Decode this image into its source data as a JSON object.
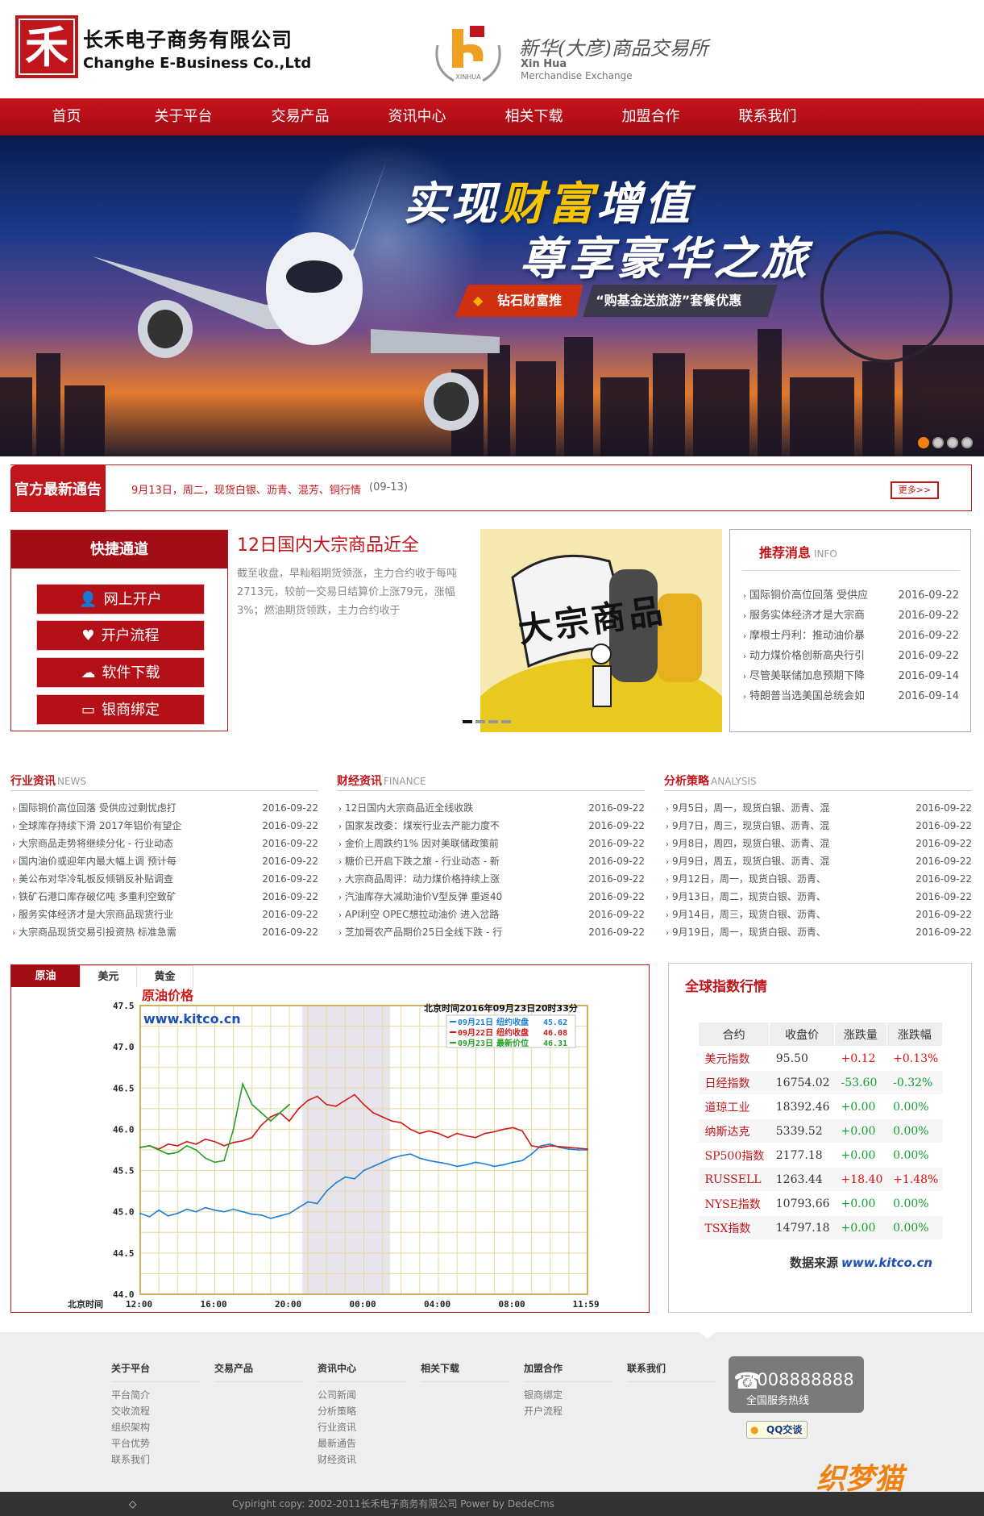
{
  "header": {
    "logo_char": "禾",
    "company_cn": "长禾电子商务有限公司",
    "company_en": "Changhe E-Business Co.,Ltd",
    "partner_cn": "新华(大彦)商品交易所",
    "partner_en1": "Xin Hua",
    "partner_en2": "Merchandise Exchange",
    "partner_logo_text": "XINHUA"
  },
  "nav": [
    "首页",
    "关于平台",
    "交易产品",
    "资讯中心",
    "相关下载",
    "加盟合作",
    "联系我们"
  ],
  "banner": {
    "line1_a": "实现",
    "line1_b": "财富",
    "line1_c": "增值",
    "line2": "尊享豪华之旅",
    "tag1": "钻石财富推出",
    "tag2": "“购基金送旅游”套餐优惠活动"
  },
  "notice": {
    "title": "官方最新通告",
    "text": "9月13日，周二，现货白银、沥青、混芳、铜行情",
    "date": "(09-13)",
    "more": "更多>>"
  },
  "quick": {
    "title": "快捷通道",
    "buttons": [
      "网上开户",
      "开户流程",
      "软件下载",
      "银商绑定"
    ]
  },
  "feature": {
    "title": "12日国内大宗商品近全",
    "body": "截至收盘，早籼稻期货领涨，主力合约收于每吨2713元，较前一交易日结算价上涨79元，涨幅3%；燃油期货领跌，主力合约收于",
    "image_text": "大宗商品"
  },
  "recommend": {
    "title": "推荐消息",
    "sub": "INFO",
    "items": [
      {
        "t": "国际铜价高位回落 受供应",
        "d": "2016-09-22"
      },
      {
        "t": "服务实体经济才是大宗商",
        "d": "2016-09-22"
      },
      {
        "t": "摩根士丹利：推动油价暴",
        "d": "2016-09-22"
      },
      {
        "t": "动力煤价格创新高央行引",
        "d": "2016-09-22"
      },
      {
        "t": "尽管美联储加息预期下降",
        "d": "2016-09-14"
      },
      {
        "t": "特朗普当选美国总统会如",
        "d": "2016-09-14"
      }
    ]
  },
  "columns": [
    {
      "title": "行业资讯",
      "sub": "NEWS",
      "items": [
        {
          "t": "国际铜价高位回落 受供应过剩忧虑打",
          "d": "2016-09-22"
        },
        {
          "t": "全球库存持续下滑 2017年铝价有望企",
          "d": "2016-09-22"
        },
        {
          "t": "大宗商品走势将继续分化 - 行业动态",
          "d": "2016-09-22"
        },
        {
          "t": "国内油价或迎年内最大幅上调 预计每",
          "d": "2016-09-22"
        },
        {
          "t": "美公布对华冷轧板反倾销反补贴调查",
          "d": "2016-09-22"
        },
        {
          "t": "铁矿石港口库存破亿吨 多重利空致矿",
          "d": "2016-09-22"
        },
        {
          "t": "服务实体经济才是大宗商品现货行业",
          "d": "2016-09-22"
        },
        {
          "t": "大宗商品现货交易引投资热 标准急需",
          "d": "2016-09-22"
        }
      ]
    },
    {
      "title": "财经资讯",
      "sub": "FINANCE",
      "items": [
        {
          "t": "12日国内大宗商品近全线收跌",
          "d": "2016-09-22"
        },
        {
          "t": "国家发改委：煤炭行业去产能力度不",
          "d": "2016-09-22"
        },
        {
          "t": "金价上周跌约1% 因对美联储政策前",
          "d": "2016-09-22"
        },
        {
          "t": "糖价已开启下跌之旅 - 行业动态 - 新",
          "d": "2016-09-22"
        },
        {
          "t": "大宗商品周评：动力煤价格持续上涨",
          "d": "2016-09-22"
        },
        {
          "t": "汽油库存大减助油价V型反弹 重返40",
          "d": "2016-09-22"
        },
        {
          "t": "API利空 OPEC想拉动油价 进入岔路",
          "d": "2016-09-22"
        },
        {
          "t": "芝加哥农产品期价25日全线下跌 - 行",
          "d": "2016-09-22"
        }
      ]
    },
    {
      "title": "分析策略",
      "sub": "ANALYSIS",
      "items": [
        {
          "t": "9月5日，周一，现货白银、沥青、混",
          "d": "2016-09-22"
        },
        {
          "t": "9月7日，周三，现货白银、沥青、混",
          "d": "2016-09-22"
        },
        {
          "t": "9月8日，周四，现货白银、沥青、混",
          "d": "2016-09-22"
        },
        {
          "t": "9月9日，周五，现货白银、沥青、混",
          "d": "2016-09-22"
        },
        {
          "t": "9月12日，周一，现货白银、沥青、",
          "d": "2016-09-22"
        },
        {
          "t": "9月13日，周二，现货白银、沥青、",
          "d": "2016-09-22"
        },
        {
          "t": "9月14日，周三，现货白银、沥青、",
          "d": "2016-09-22"
        },
        {
          "t": "9月19日，周一，现货白银、沥青、",
          "d": "2016-09-22"
        }
      ]
    }
  ],
  "chart_tabs": [
    "原油",
    "美元",
    "黄金"
  ],
  "chart_data": {
    "type": "line",
    "title": "原油价格",
    "source_label": "www.kitco.cn",
    "time_label": "北京时间2016年09月23日20时33分",
    "xlabel_prefix": "北京时间",
    "x_ticks": [
      "12:00",
      "16:00",
      "20:00",
      "00:00",
      "04:00",
      "08:00",
      "11:59"
    ],
    "y_ticks": [
      "47.5",
      "47.0",
      "46.5",
      "46.0",
      "45.5",
      "45.0",
      "44.5",
      "44.0"
    ],
    "ylim": [
      44.0,
      47.5
    ],
    "legend": [
      {
        "date": "09月21日",
        "label": "纽约收盘",
        "value": "45.62",
        "color": "#1a7fd8"
      },
      {
        "date": "09月22日",
        "label": "纽约收盘",
        "value": "46.08",
        "color": "#d01818"
      },
      {
        "date": "09月23日",
        "label": "最新价位",
        "value": "46.31",
        "color": "#22a022"
      }
    ],
    "series": [
      {
        "name": "09月21日",
        "color": "#1a7fd8",
        "x": [
          0,
          0.5,
          1,
          1.5,
          2,
          2.5,
          3,
          3.5,
          4,
          4.5,
          5,
          5.5,
          6,
          6.5,
          7,
          7.5,
          8,
          8.5,
          9,
          9.5,
          10,
          10.5,
          11,
          11.5,
          12,
          12.5,
          13,
          13.5,
          14,
          14.5,
          15,
          15.5,
          16,
          16.5,
          17,
          17.5,
          18,
          18.5,
          19,
          19.5,
          20,
          20.5,
          21,
          21.5,
          22,
          22.5,
          23,
          23.5,
          24
        ],
        "values": [
          44.98,
          44.94,
          45.02,
          44.95,
          44.98,
          45.03,
          45.0,
          45.05,
          45.02,
          45.0,
          45.03,
          45.0,
          44.97,
          44.96,
          44.92,
          44.95,
          44.98,
          45.05,
          45.12,
          45.1,
          45.25,
          45.35,
          45.42,
          45.4,
          45.5,
          45.55,
          45.6,
          45.65,
          45.68,
          45.7,
          45.65,
          45.62,
          45.6,
          45.58,
          45.55,
          45.57,
          45.6,
          45.58,
          45.55,
          45.57,
          45.6,
          45.62,
          45.7,
          45.8,
          45.82,
          45.78,
          45.76,
          45.75,
          45.75
        ]
      },
      {
        "name": "09月22日",
        "color": "#d01818",
        "x": [
          0,
          0.5,
          1,
          1.5,
          2,
          2.5,
          3,
          3.5,
          4,
          4.5,
          5,
          5.5,
          6,
          6.5,
          7,
          7.5,
          8,
          8.5,
          9,
          9.5,
          10,
          10.5,
          11,
          11.5,
          12,
          12.5,
          13,
          13.5,
          14,
          14.5,
          15,
          15.5,
          16,
          16.5,
          17,
          17.5,
          18,
          18.5,
          19,
          19.5,
          20,
          20.5,
          21,
          21.5,
          22,
          22.5,
          23,
          23.5,
          24
        ],
        "values": [
          45.78,
          45.8,
          45.76,
          45.82,
          45.8,
          45.85,
          45.82,
          45.88,
          45.85,
          45.8,
          45.84,
          45.86,
          45.9,
          46.05,
          46.15,
          46.2,
          46.1,
          46.25,
          46.35,
          46.4,
          46.3,
          46.28,
          46.35,
          46.42,
          46.3,
          46.2,
          46.15,
          46.1,
          46.08,
          46.0,
          45.95,
          45.98,
          45.95,
          45.9,
          45.95,
          45.92,
          45.9,
          45.95,
          45.97,
          46.0,
          46.02,
          45.98,
          45.8,
          45.78,
          45.8,
          45.79,
          45.78,
          45.77,
          45.76
        ]
      },
      {
        "name": "09月23日",
        "color": "#22a022",
        "x": [
          0,
          0.5,
          1,
          1.5,
          2,
          2.5,
          3,
          3.5,
          4,
          4.5,
          5,
          5.5,
          6,
          6.5,
          7,
          7.5,
          8
        ],
        "values": [
          45.78,
          45.8,
          45.75,
          45.7,
          45.72,
          45.8,
          45.75,
          45.65,
          45.6,
          45.62,
          46.0,
          46.55,
          46.3,
          46.2,
          46.1,
          46.2,
          46.3
        ]
      }
    ]
  },
  "index": {
    "title": "全球指数行情",
    "headers": [
      "合约",
      "收盘价",
      "涨跌量",
      "涨跌幅"
    ],
    "rows": [
      {
        "n": "美元指数",
        "v": "95.50",
        "c": "+0.12",
        "p": "+0.13%",
        "dir": "up"
      },
      {
        "n": "日经指数",
        "v": "16754.02",
        "c": "-53.60",
        "p": "-0.32%",
        "dir": "dn"
      },
      {
        "n": "道琼工业",
        "v": "18392.46",
        "c": "+0.00",
        "p": "0.00%",
        "dir": "dn"
      },
      {
        "n": "纳斯达克",
        "v": "5339.52",
        "c": "+0.00",
        "p": "0.00%",
        "dir": "dn"
      },
      {
        "n": "SP500指数",
        "v": "2177.18",
        "c": "+0.00",
        "p": "0.00%",
        "dir": "dn"
      },
      {
        "n": "RUSSELL",
        "v": "1263.44",
        "c": "+18.40",
        "p": "+1.48%",
        "dir": "up"
      },
      {
        "n": "NYSE指数",
        "v": "10793.66",
        "c": "+0.00",
        "p": "0.00%",
        "dir": "dn"
      },
      {
        "n": "TSX指数",
        "v": "14797.18",
        "c": "+0.00",
        "p": "0.00%",
        "dir": "dn"
      }
    ],
    "source_prefix": "数据来源",
    "source": "www.kitco.cn"
  },
  "footer": {
    "cols": [
      {
        "h": "关于平台",
        "items": [
          "平台简介",
          "交收流程",
          "组织架构",
          "平台优势",
          "联系我们"
        ]
      },
      {
        "h": "交易产品",
        "items": []
      },
      {
        "h": "资讯中心",
        "items": [
          "公司新闻",
          "分析策略",
          "行业资讯",
          "最新通告",
          "财经资讯"
        ]
      },
      {
        "h": "相关下载",
        "items": []
      },
      {
        "h": "加盟合作",
        "items": [
          "银商绑定",
          "开户流程"
        ]
      },
      {
        "h": "联系我们",
        "items": []
      }
    ],
    "hotline": "4008888888",
    "hotline_label": "全国服务热线",
    "qq": "QQ交谈",
    "copyright": "Cypiright copy: 2002-2011长禾电子商务有限公司 Power by DedeCms",
    "watermark": "织梦猫"
  }
}
